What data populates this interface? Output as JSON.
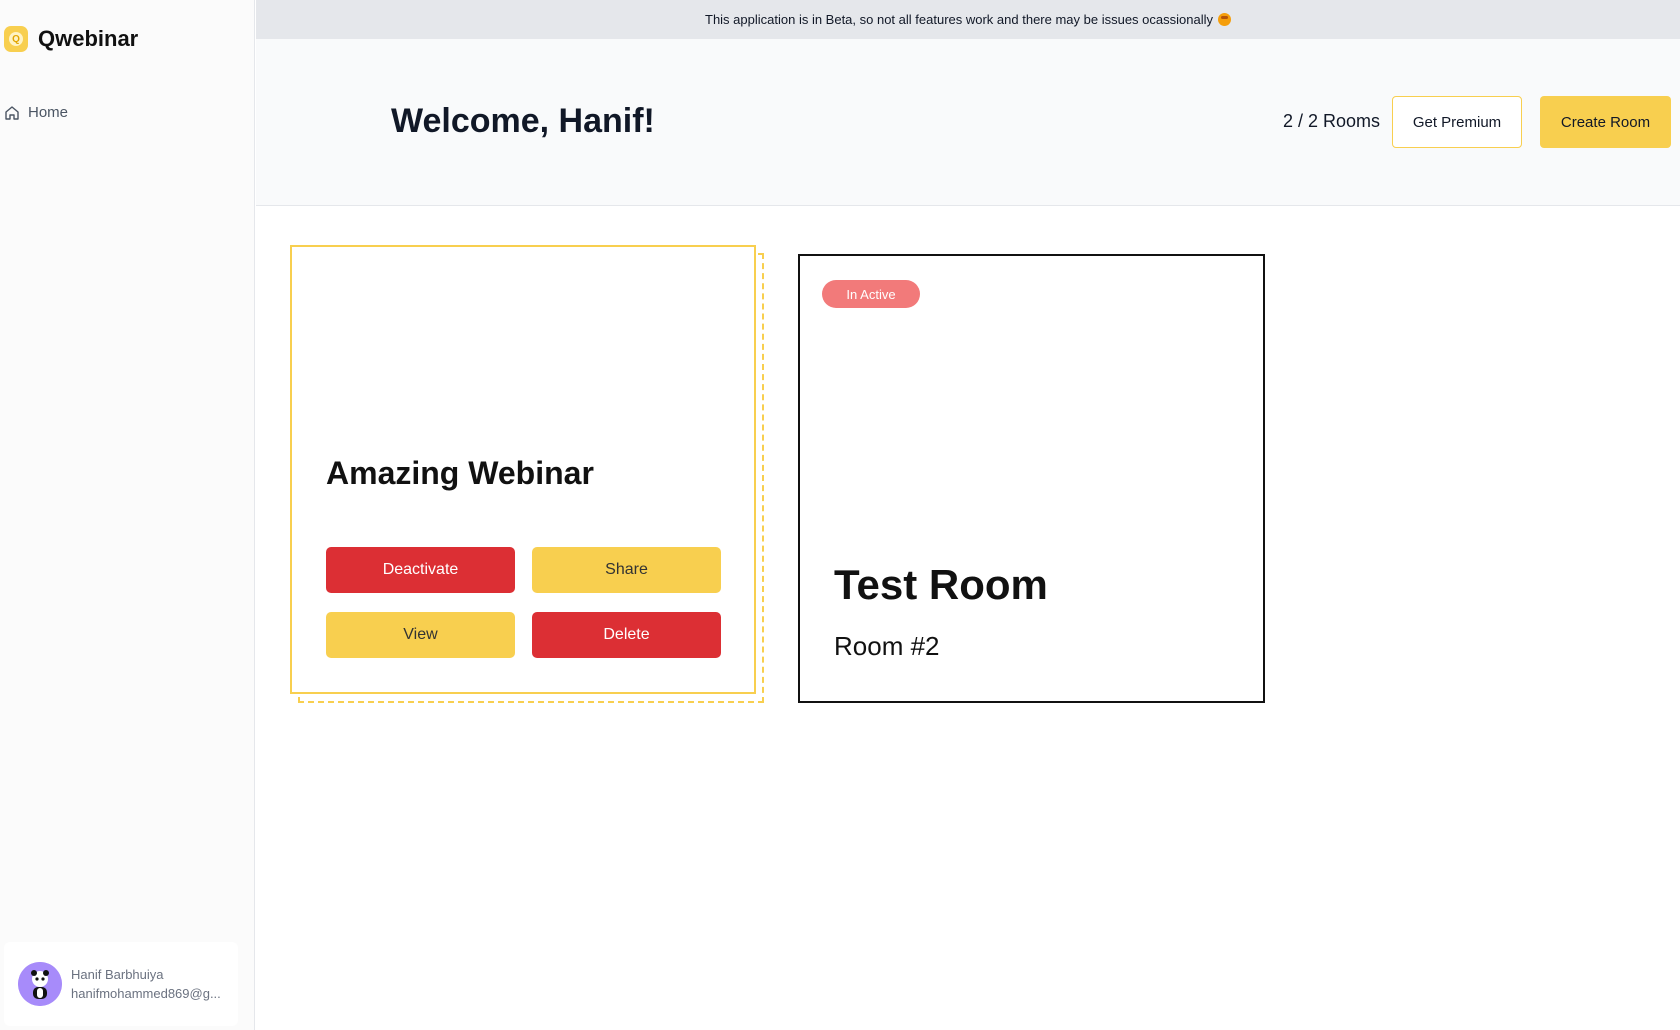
{
  "app": {
    "name": "Qwebinar",
    "logo_letter": "Q"
  },
  "sidebar": {
    "nav": [
      {
        "label": "Home",
        "icon": "home-icon"
      }
    ],
    "user": {
      "name": "Hanif Barbhuiya",
      "email": "hanifmohammed869@g..."
    }
  },
  "banner": {
    "text": "This application is in Beta, so not all features work and there may be issues ocassionally",
    "emoji_icon": "face-emoji-icon"
  },
  "header": {
    "welcome": "Welcome, Hanif!",
    "rooms_count": "2 / 2 Rooms",
    "premium_label": "Get Premium",
    "create_label": "Create Room"
  },
  "rooms": [
    {
      "title": "Amazing Webinar",
      "actions": {
        "deactivate": "Deactivate",
        "share": "Share",
        "view": "View",
        "delete": "Delete"
      }
    },
    {
      "status": "In Active",
      "title": "Test Room",
      "subtitle": "Room #2"
    }
  ],
  "colors": {
    "accent": "#f8cf4f",
    "danger": "#dc2f34",
    "inactive_badge": "#f27a7a",
    "text": "#111827"
  }
}
